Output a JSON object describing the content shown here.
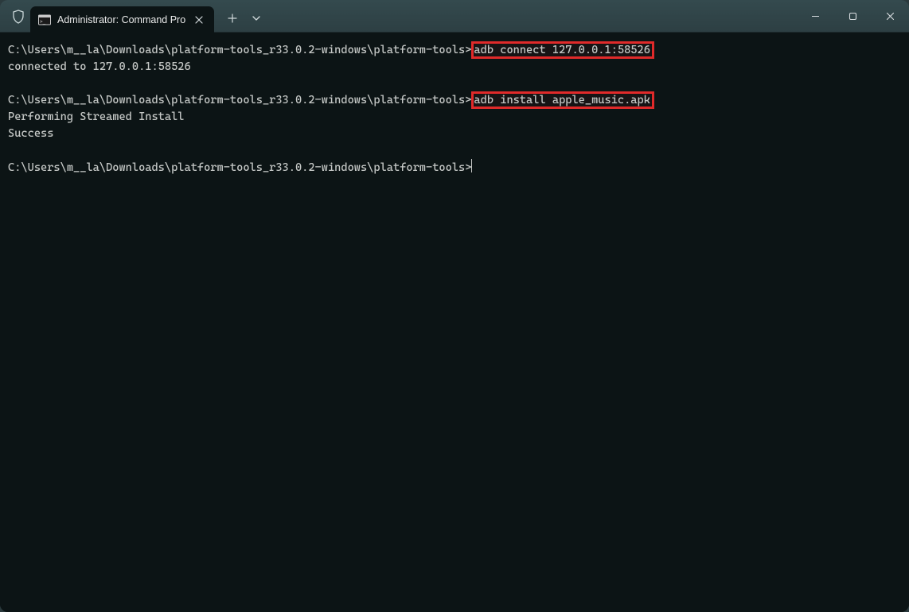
{
  "titlebar": {
    "tab_title": "Administrator: Command Pro"
  },
  "terminal": {
    "prompt": "C:\\Users\\m__la\\Downloads\\platform-tools_r33.0.2-windows\\platform-tools>",
    "cmd1": "adb connect 127.0.0.1:58526",
    "out1": "connected to 127.0.0.1:58526",
    "cmd2": "adb install apple_music.apk",
    "out2a": "Performing Streamed Install",
    "out2b": "Success"
  }
}
